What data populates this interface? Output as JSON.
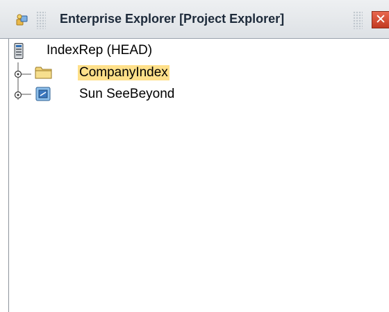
{
  "window": {
    "title": "Enterprise Explorer [Project Explorer]",
    "title_icon": "explorer-icon",
    "close_glyph": "✕",
    "close_color": "#c23a22"
  },
  "tree": {
    "root": {
      "label": "IndexRep (HEAD)",
      "icon": "repository-icon"
    },
    "children": [
      {
        "label": "CompanyIndex",
        "icon": "folder-icon",
        "selected": true,
        "selection_color": "#ffe08a"
      },
      {
        "label": "Sun SeeBeyond",
        "icon": "project-icon",
        "selected": false
      }
    ]
  }
}
